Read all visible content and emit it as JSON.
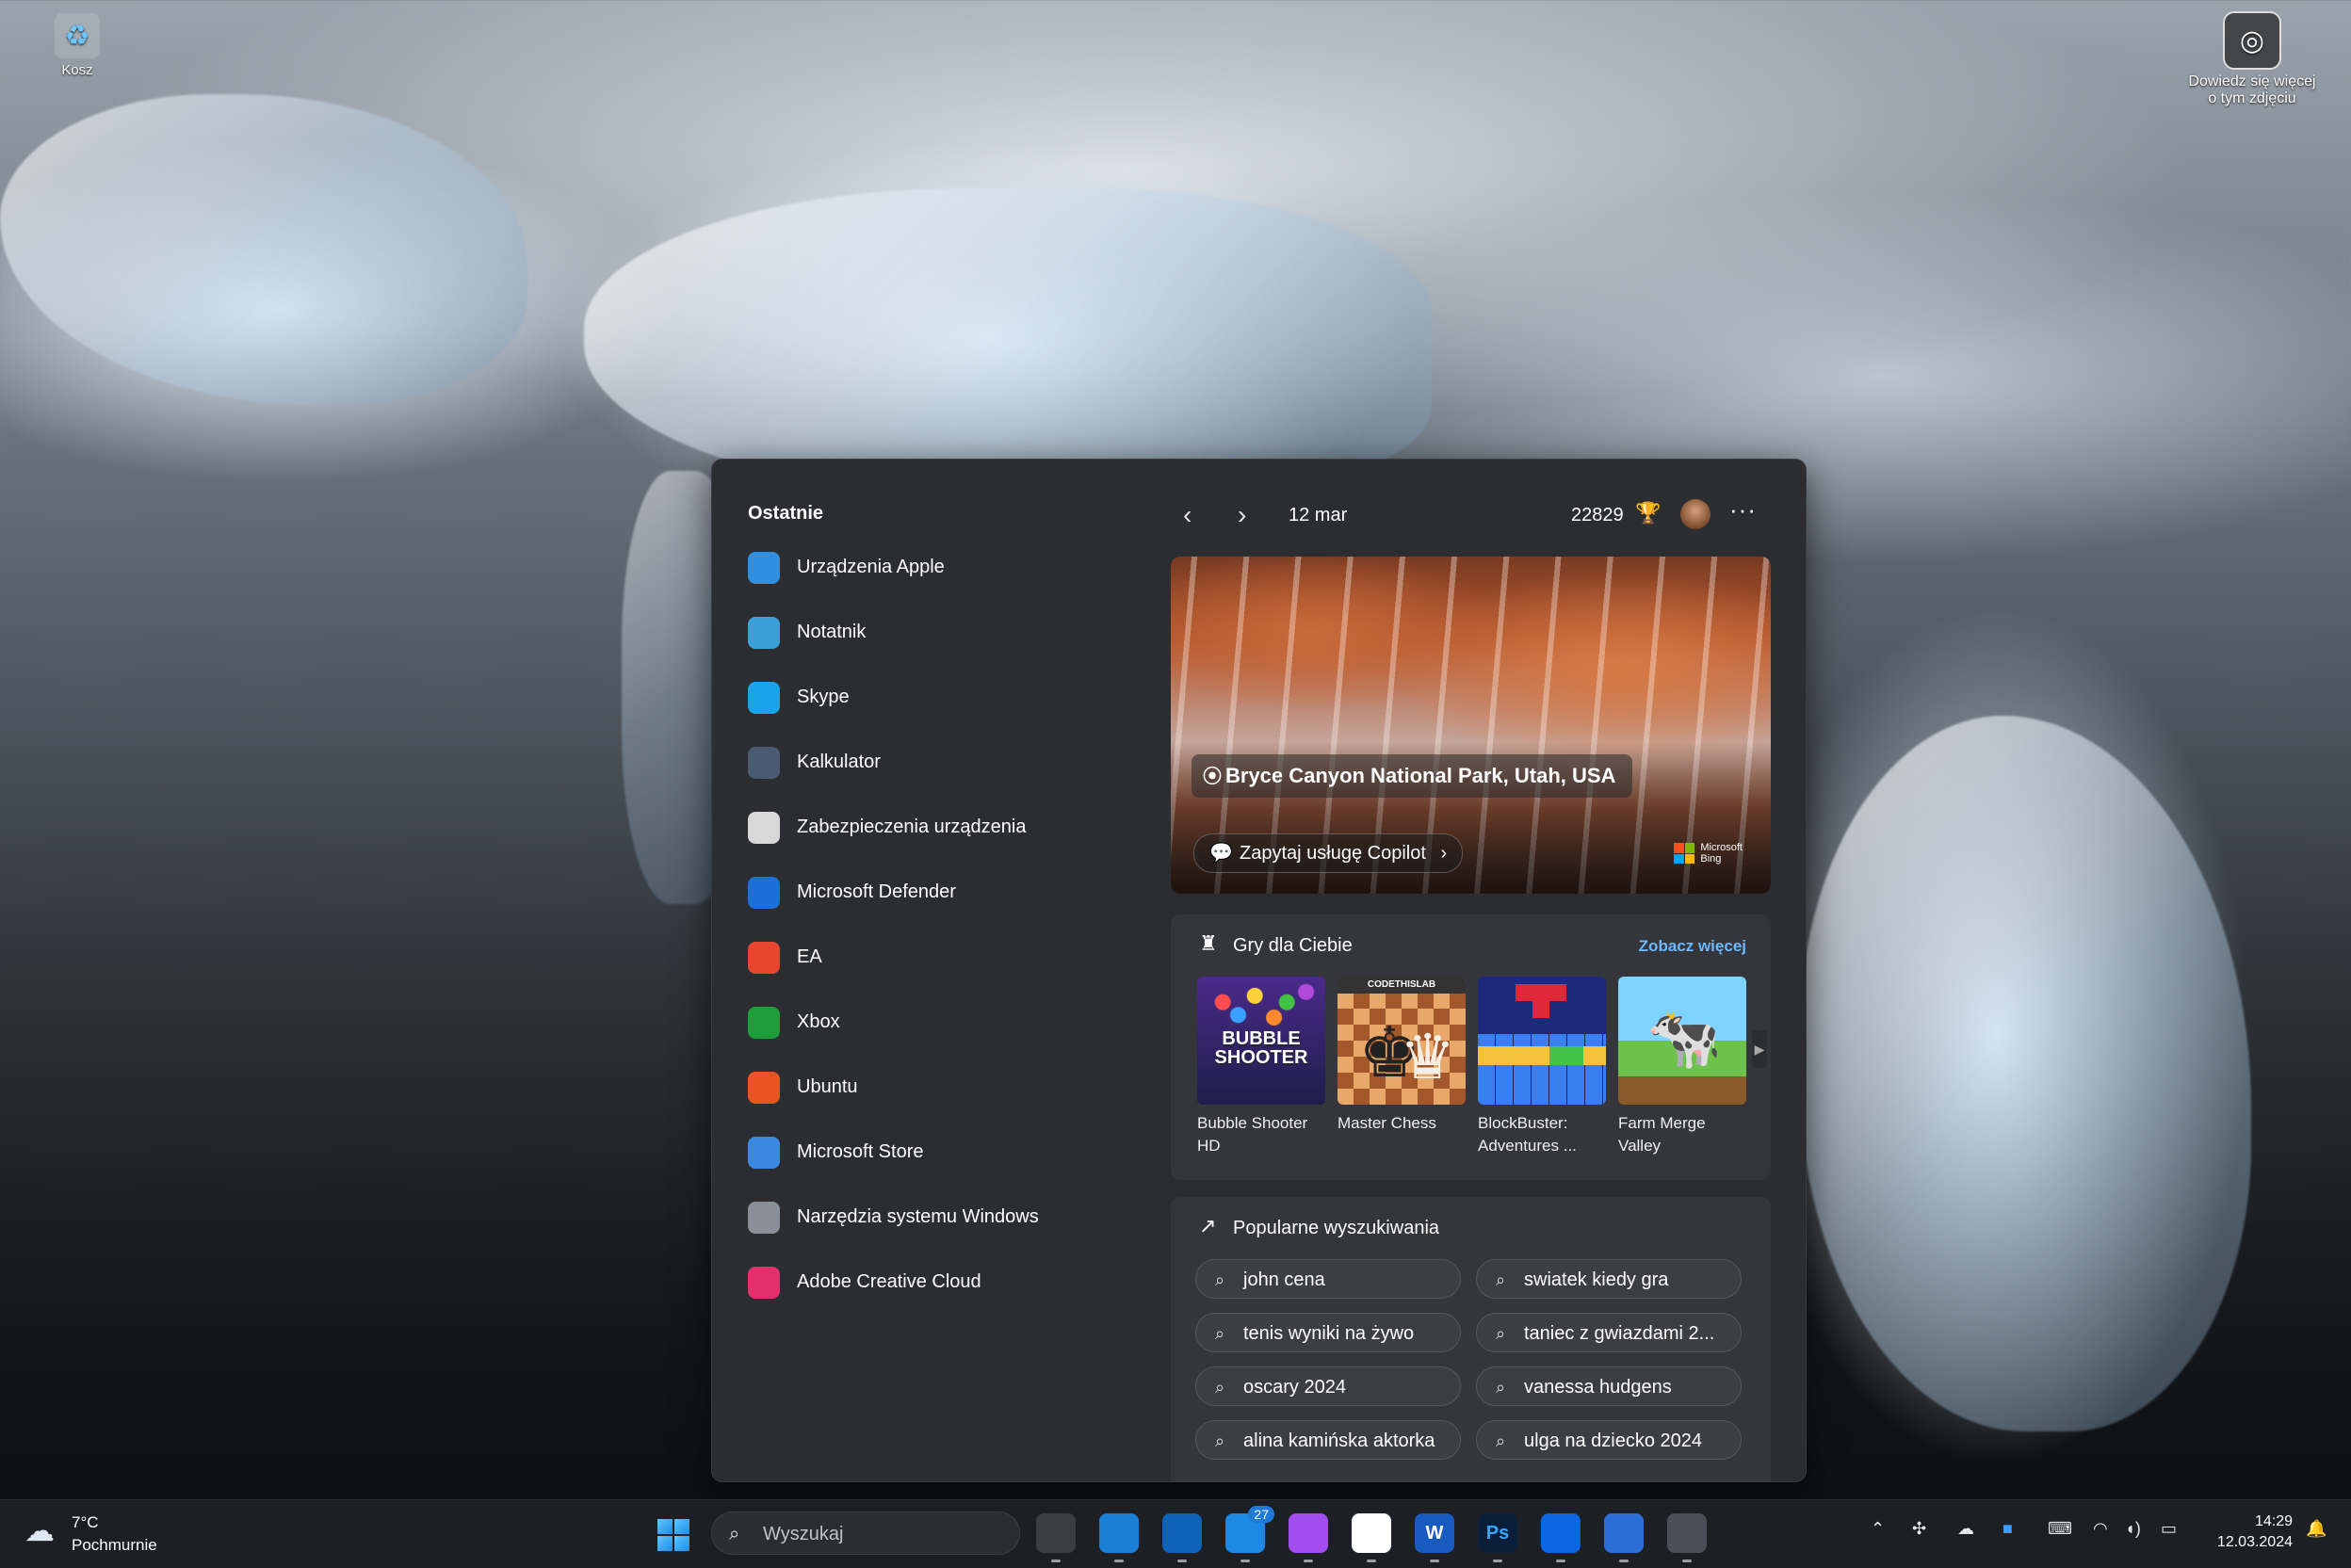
{
  "desktop": {
    "recycle_bin_label": "Kosz",
    "spotlight_label_line1": "Dowiedz się więcej",
    "spotlight_label_line2": "o tym zdjęciu"
  },
  "widgets": {
    "recent_title": "Ostatnie",
    "recent_items": [
      {
        "label": "Urządzenia Apple",
        "icon": "apple-devices-icon",
        "color": "#2f8fe0"
      },
      {
        "label": "Notatnik",
        "icon": "notepad-icon",
        "color": "#3aa0d8"
      },
      {
        "label": "Skype",
        "icon": "skype-icon",
        "color": "#1aa3e8"
      },
      {
        "label": "Kalkulator",
        "icon": "calculator-icon",
        "color": "#4a5a70"
      },
      {
        "label": "Zabezpieczenia urządzenia",
        "icon": "shield-icon",
        "color": "#d8d8d8"
      },
      {
        "label": "Microsoft Defender",
        "icon": "defender-icon",
        "color": "#1b6fd6"
      },
      {
        "label": "EA",
        "icon": "ea-icon",
        "color": "#e8452e"
      },
      {
        "label": "Xbox",
        "icon": "xbox-icon",
        "color": "#1f9d3b"
      },
      {
        "label": "Ubuntu",
        "icon": "ubuntu-icon",
        "color": "#e95420"
      },
      {
        "label": "Microsoft Store",
        "icon": "store-icon",
        "color": "#3b88e0"
      },
      {
        "label": "Narzędzia systemu Windows",
        "icon": "windows-tools-icon",
        "color": "#8a8f98"
      },
      {
        "label": "Adobe Creative Cloud",
        "icon": "creative-cloud-icon",
        "color": "#e1306c"
      }
    ],
    "header": {
      "prev_glyph": "‹",
      "next_glyph": "›",
      "date": "12 mar",
      "points": "22829",
      "more": "···"
    },
    "hero": {
      "location": "Bryce Canyon National Park, Utah, USA",
      "copilot_button": "Zapytaj usługę Copilot",
      "bing_line1": "Microsoft",
      "bing_line2": "Bing"
    },
    "games": {
      "title": "Gry dla Ciebie",
      "see_more": "Zobacz więcej",
      "items": [
        {
          "name": "Bubble Shooter HD",
          "art_text": "BUBBLE SHOOTER"
        },
        {
          "name": "Master Chess",
          "art_text": "CODETHISLAB"
        },
        {
          "name": "BlockBuster: Adventures ...",
          "art_text": ""
        },
        {
          "name": "Farm Merge Valley",
          "art_text": ""
        }
      ]
    },
    "popular": {
      "title": "Popularne wyszukiwania",
      "items": [
        "john cena",
        "swiatek kiedy gra",
        "tenis wyniki na żywo",
        "taniec z gwiazdami 2...",
        "oscary 2024",
        "vanessa hudgens",
        "alina kamińska aktorka",
        "ulga na dziecko 2024"
      ]
    }
  },
  "taskbar": {
    "weather_temp": "7°C",
    "weather_desc": "Pochmurnie",
    "search_placeholder": "Wyszukaj",
    "apps": [
      {
        "name": "task-view-icon",
        "label": ""
      },
      {
        "name": "edge-icon",
        "label": ""
      },
      {
        "name": "outlook-icon",
        "label": ""
      },
      {
        "name": "mail-icon",
        "label": "",
        "badge": "27"
      },
      {
        "name": "messenger-icon",
        "label": ""
      },
      {
        "name": "slack-icon",
        "label": ""
      },
      {
        "name": "word-icon",
        "label": "W"
      },
      {
        "name": "photoshop-icon",
        "label": "Ps"
      },
      {
        "name": "trello-icon",
        "label": ""
      },
      {
        "name": "translator-icon",
        "label": ""
      },
      {
        "name": "settings-icon",
        "label": ""
      }
    ],
    "time": "14:29",
    "date": "12.03.2024"
  }
}
